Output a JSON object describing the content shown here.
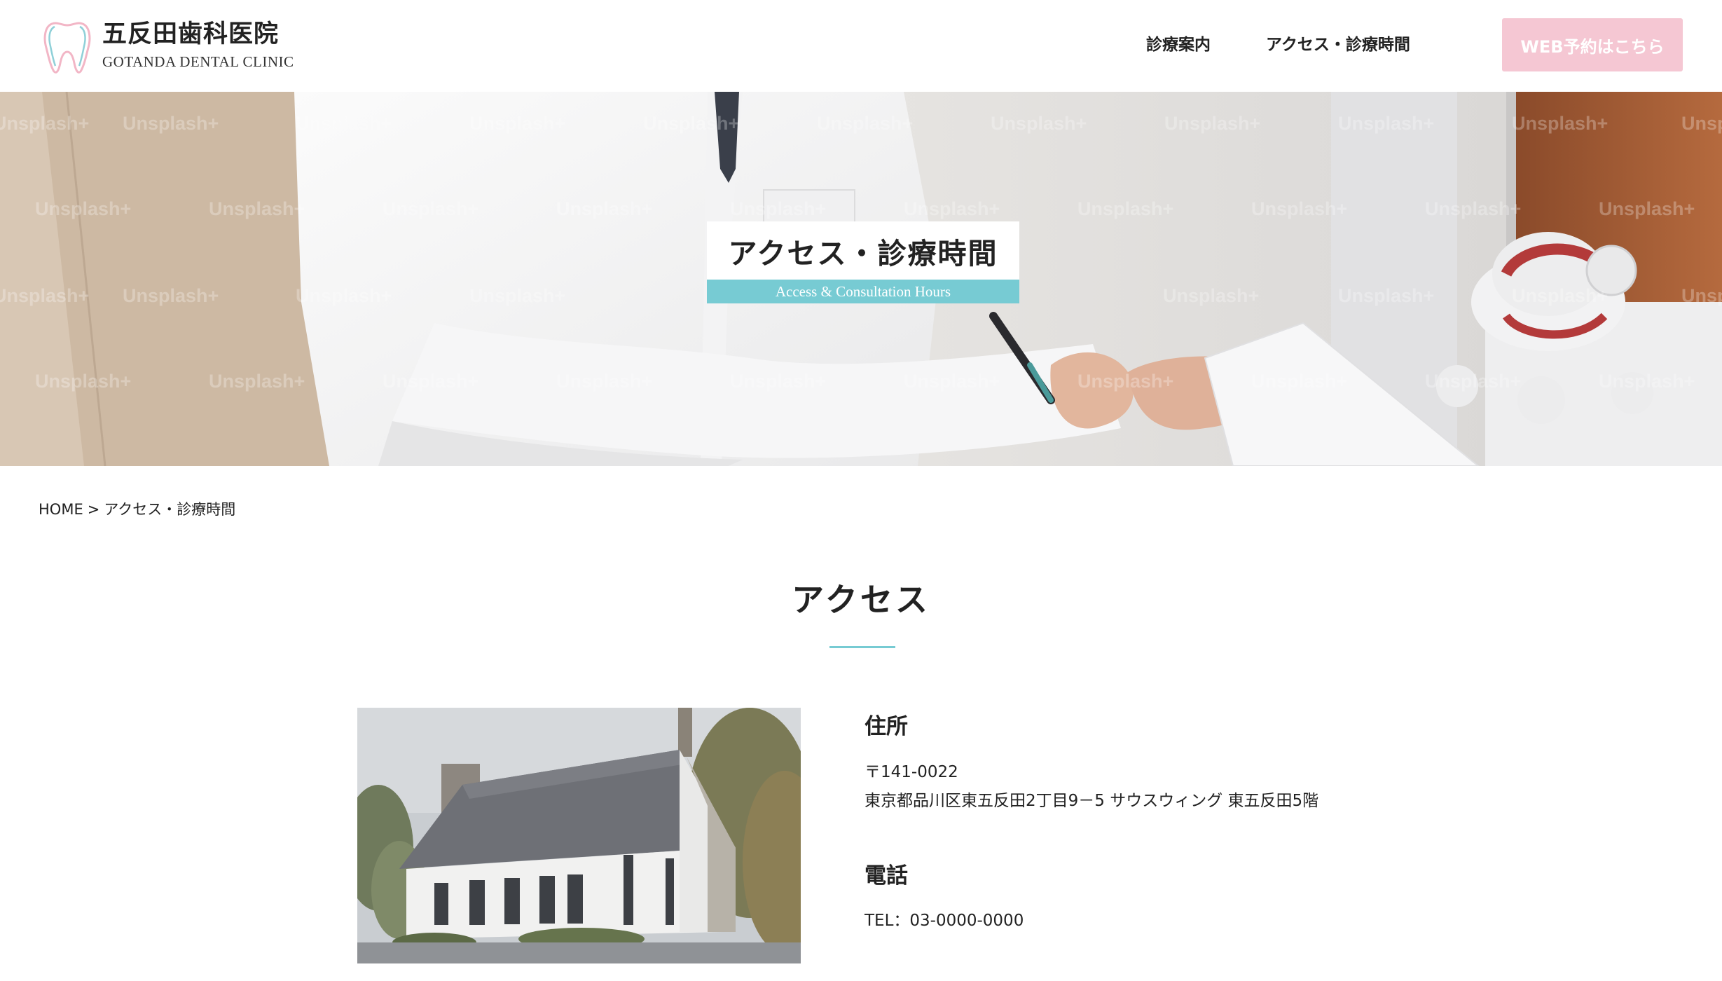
{
  "header": {
    "logo_jp": "五反田歯科医院",
    "logo_en": "GOTANDA DENTAL CLINIC",
    "nav": [
      "診療案内",
      "アクセス・診療時間"
    ],
    "reserve_label": "WEB予約はこちら"
  },
  "hero": {
    "title": "アクセス・診療時間",
    "subtitle": "Access & Consultation Hours",
    "watermark": "Unsplash+"
  },
  "breadcrumb": {
    "home": "HOME",
    "separator": ">",
    "current": "アクセス・診療時間"
  },
  "access": {
    "title": "アクセス",
    "address_heading": "住所",
    "postal": "〒141-0022",
    "address": "東京都品川区東五反田2丁目9－5 サウスウィング 東五反田5階",
    "phone_heading": "電話",
    "phone": "TEL：03-0000-0000"
  },
  "colors": {
    "accent_teal": "#77cbd3",
    "button_pink": "#f5c7d3",
    "text": "#222222"
  },
  "icons": {
    "logo": "tooth-icon"
  }
}
